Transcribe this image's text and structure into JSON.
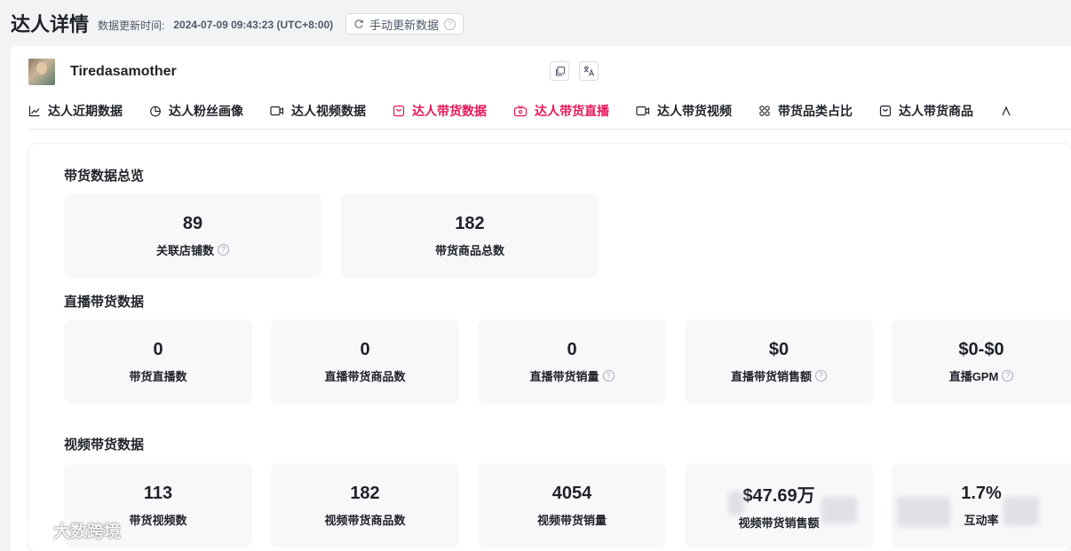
{
  "header": {
    "title": "达人详情",
    "update_label": "数据更新时间:",
    "update_time": "2024-07-09 09:43:23 (UTC+8:00)",
    "refresh_label": "手动更新数据"
  },
  "profile": {
    "name": "Tiredasamother"
  },
  "tabs": [
    {
      "label": "达人近期数据",
      "icon": "line-chart-icon"
    },
    {
      "label": "达人粉丝画像",
      "icon": "pie-chart-icon"
    },
    {
      "label": "达人视频数据",
      "icon": "video-icon"
    },
    {
      "label": "达人带货数据",
      "icon": "shopping-bag-icon",
      "active": true
    },
    {
      "label": "达人带货直播",
      "icon": "live-tv-icon"
    },
    {
      "label": "达人带货视频",
      "icon": "video-icon"
    },
    {
      "label": "带货品类占比",
      "icon": "grid-icon"
    },
    {
      "label": "达人带货商品",
      "icon": "shopping-bag-icon"
    }
  ],
  "sections": {
    "overview": {
      "title": "带货数据总览",
      "cards": [
        {
          "value": "89",
          "label": "关联店铺数",
          "help": true
        },
        {
          "value": "182",
          "label": "带货商品总数",
          "help": false
        }
      ]
    },
    "live": {
      "title": "直播带货数据",
      "cards": [
        {
          "value": "0",
          "label": "带货直播数",
          "help": false
        },
        {
          "value": "0",
          "label": "直播带货商品数",
          "help": false
        },
        {
          "value": "0",
          "label": "直播带货销量",
          "help": true
        },
        {
          "value": "$0",
          "label": "直播带货销售额",
          "help": true
        },
        {
          "value": "$0-$0",
          "label": "直播GPM",
          "help": true
        }
      ]
    },
    "video": {
      "title": "视频带货数据",
      "cards": [
        {
          "value": "113",
          "label": "带货视频数",
          "help": false
        },
        {
          "value": "182",
          "label": "视频带货商品数",
          "help": false
        },
        {
          "value": "4054",
          "label": "视频带货销量",
          "help": false
        },
        {
          "value": "$47.69万",
          "label": "视频带货销售额",
          "help": false
        },
        {
          "value": "1.7%",
          "label": "互动率",
          "help": false
        }
      ]
    }
  },
  "watermark": {
    "text": "大数跨境"
  },
  "colors": {
    "accent": "#e8185a",
    "card_bg": "#f7f8fa",
    "page_bg": "#f2f3f5"
  }
}
